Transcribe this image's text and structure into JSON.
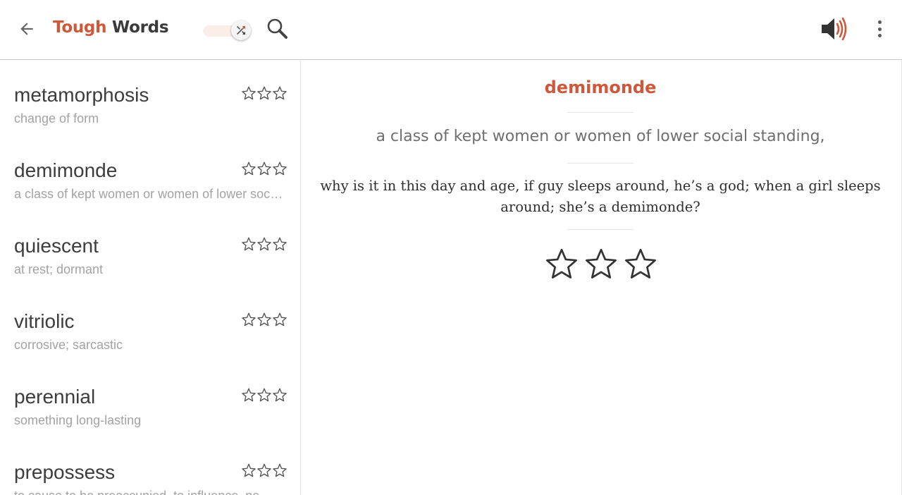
{
  "app": {
    "title_part1": "Tough",
    "title_part2": "Words"
  },
  "toolbar": {
    "back_icon": "arrow-left-icon",
    "shuffle_icon": "shuffle-icon",
    "shuffle_on": true,
    "search_icon": "search-icon",
    "sound_icon": "volume-icon",
    "menu_icon": "more-vert-icon"
  },
  "words": [
    {
      "word": "metamorphosis",
      "definition": "change of form",
      "rating": 0
    },
    {
      "word": "demimonde",
      "definition": "a class of kept women or women of lower social standing,",
      "rating": 0
    },
    {
      "word": "quiescent",
      "definition": "at rest; dormant",
      "rating": 0
    },
    {
      "word": "vitriolic",
      "definition": "corrosive; sarcastic",
      "rating": 0
    },
    {
      "word": "perennial",
      "definition": "something long-lasting",
      "rating": 0
    },
    {
      "word": "prepossess",
      "definition": "to cause to be preoccupied, to influence, ne",
      "rating": 0
    }
  ],
  "detail": {
    "word": "demimonde",
    "definition": "a class of kept women or women of lower social standing,",
    "example": "why is it in this day and age, if guy sleeps around, he’s a god; when a girl sleeps around; she’s a demimonde?",
    "rating": 0,
    "max_rating": 3
  },
  "colors": {
    "accent": "#d0583a",
    "text_dark": "#3d3d3d",
    "text_muted": "#a3a3a3"
  }
}
